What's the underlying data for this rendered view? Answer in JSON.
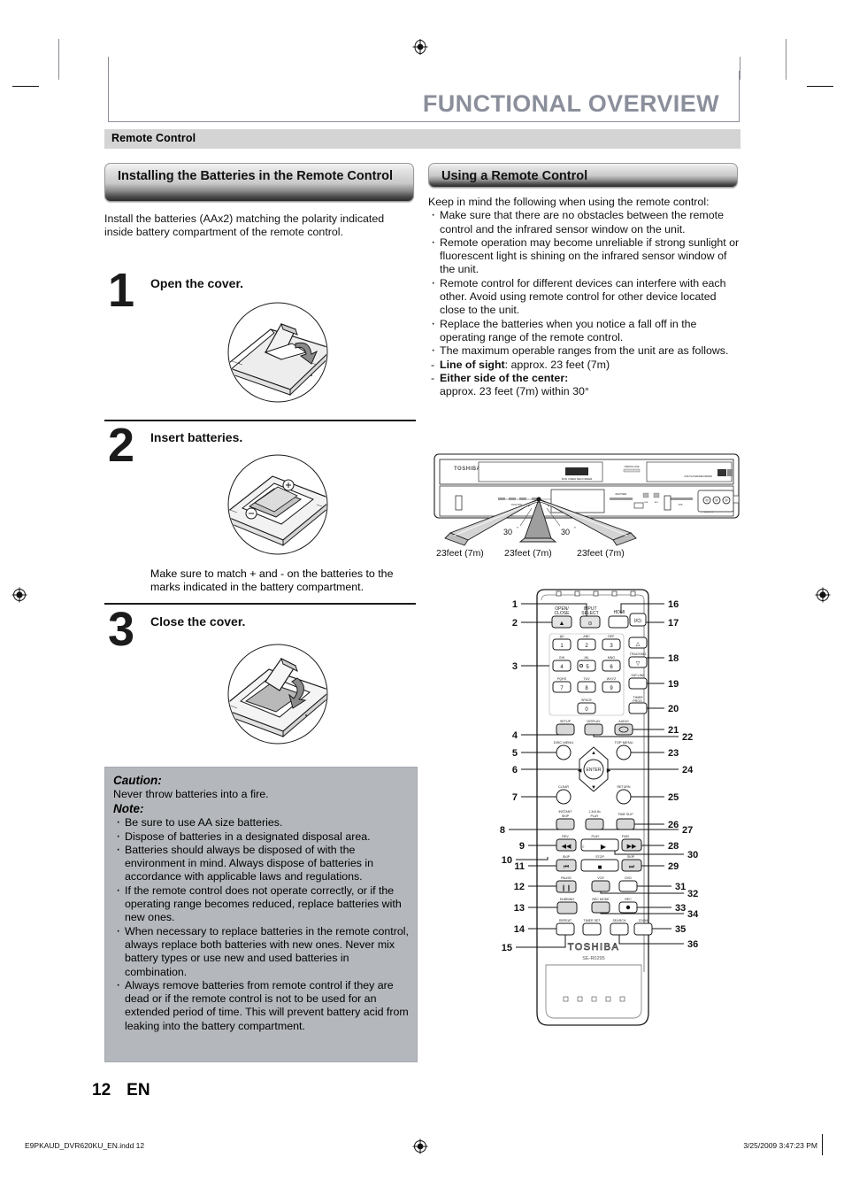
{
  "page": {
    "title": "FUNCTIONAL OVERVIEW",
    "section_bar": "Remote Control",
    "page_number": "12",
    "language_code": "EN"
  },
  "left_column": {
    "heading": "Installing the Batteries in the Remote Control",
    "intro": "Install the batteries (AAx2) matching the polarity indicated inside battery compartment of the remote control.",
    "steps": [
      {
        "number": "1",
        "title": "Open the cover.",
        "figure": "remote-open-cover-illustration"
      },
      {
        "number": "2",
        "title": "Insert batteries.",
        "figure": "remote-insert-batteries-illustration",
        "caption": "Make sure to match + and - on the batteries to the marks indicated in the battery compartment."
      },
      {
        "number": "3",
        "title": "Close the cover.",
        "figure": "remote-close-cover-illustration"
      }
    ],
    "notice": {
      "caution_heading": "Caution:",
      "caution_text": "Never throw batteries into a fire.",
      "note_heading": "Note:",
      "notes": [
        "Be sure to use AA size batteries.",
        "Dispose of batteries in a designated disposal area.",
        "Batteries should always be disposed of with the environment in mind. Always dispose of batteries in accordance with applicable laws and regulations.",
        "If the remote control does not operate correctly, or if the operating range becomes reduced, replace batteries with new ones.",
        "When necessary to replace batteries in the remote control, always replace both batteries with new ones. Never mix battery types or use new and used batteries in combination.",
        "Always remove batteries from remote control if they are dead or if the remote control is not to be used for an extended period of time. This will prevent battery acid from leaking into the battery compartment."
      ]
    }
  },
  "right_column": {
    "heading": "Using a Remote Control",
    "intro": "Keep in mind the following when using the remote control:",
    "bullets": [
      "Make sure that there are no obstacles between the remote control and the infrared sensor window on the unit.",
      "Remote operation may become unreliable if strong sunlight or fluorescent light is shining on the infrared sensor window of the unit.",
      "Remote control for different devices can interfere with each other. Avoid using remote control for other device located close to the unit.",
      "Replace the batteries when you notice a fall off in the operating range of the remote control.",
      "The maximum operable ranges from the unit are as follows."
    ],
    "ranges": [
      {
        "label": "Line of sight",
        "sep": ": ",
        "value": "approx. 23 feet (7m)"
      },
      {
        "label": "Either side of the center:",
        "sep": "",
        "value": "approx. 23 feet (7m) within 30°"
      }
    ],
    "device_diagram": {
      "brand": "TOSHIBA",
      "angle_left": "30˚",
      "angle_right": "30˚",
      "distance_labels": [
        "23feet (7m)",
        "23feet (7m)",
        "23feet (7m)"
      ]
    },
    "remote_diagram": {
      "brand": "TOSHIBA",
      "model": "SE-R0295",
      "callout_numbers_left": [
        "1",
        "2",
        "3",
        "4",
        "5",
        "6",
        "7",
        "8",
        "9",
        "10",
        "11",
        "12",
        "13",
        "14",
        "15"
      ],
      "callout_numbers_right": [
        "16",
        "17",
        "18",
        "19",
        "20",
        "21",
        "22",
        "23",
        "24",
        "25",
        "26",
        "27",
        "28",
        "29",
        "30",
        "31",
        "32",
        "33",
        "34",
        "35",
        "36"
      ],
      "button_labels": [
        "OPEN/ CLOSE",
        "INPUT SELECT",
        "HDMI",
        "I/⏻",
        ".@/:",
        "ABC",
        "DEF",
        "GHI",
        "JKL",
        "MNO",
        "PQRS",
        "TUV",
        "WXYZ",
        "SPACE",
        "1",
        "2",
        "3",
        "4",
        "5",
        "6",
        "7",
        "8",
        "9",
        "0",
        "TRACKING",
        "SAT.LINK",
        "TIMER PROG.",
        "SETUP",
        "DISPLAY",
        "AUDIO",
        "DISC MENU",
        "TOP MENU",
        "ENTER",
        "CLEAR",
        "RETURN",
        "INSTANT SKIP",
        "1.3x/0.8x PLAY",
        "TIME SLIP",
        "REV",
        "PLAY",
        "FWD",
        "SKIP",
        "STOP",
        "SKIP",
        "PAUSE",
        "VCR",
        "DVD",
        "DUBBING",
        "REC MODE",
        "REC",
        "REPEAT",
        "TIMER SET",
        "SEARCH",
        "ZOOM"
      ]
    }
  },
  "footer": {
    "file": "E9PKAUD_DVR620KU_EN.indd   12",
    "timestamp": "3/25/2009   3:47:23 PM"
  }
}
